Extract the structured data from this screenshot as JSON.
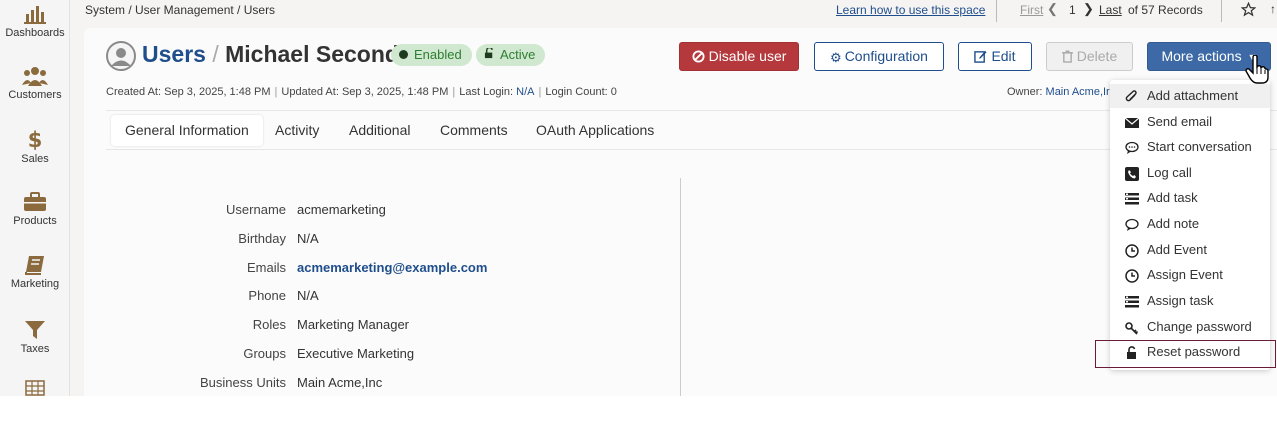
{
  "sidebar": {
    "items": [
      {
        "label": "Dashboards",
        "icon": "bar-chart-icon"
      },
      {
        "label": "Customers",
        "icon": "users-icon"
      },
      {
        "label": "Sales",
        "icon": "dollar-icon"
      },
      {
        "label": "Products",
        "icon": "briefcase-icon"
      },
      {
        "label": "Marketing",
        "icon": "book-icon"
      },
      {
        "label": "Taxes",
        "icon": "filter-icon"
      }
    ]
  },
  "topbar": {
    "breadcrumb": "System / User Management / Users",
    "learn_link": "Learn how to use this space",
    "pager_first": "First",
    "pager_page": "1",
    "pager_last": "Last",
    "pager_count": "of 57 Records"
  },
  "header": {
    "title_section": "Users",
    "title_sep": "/",
    "title_name": "Michael Second",
    "badge_enabled": "Enabled",
    "badge_active": "Active"
  },
  "actions": {
    "disable_user": "Disable user",
    "configuration": "Configuration",
    "edit": "Edit",
    "delete": "Delete",
    "more_actions": "More actions"
  },
  "meta": {
    "created_label": "Created At:",
    "created_value": "Sep 3, 2025, 1:48 PM",
    "updated_label": "Updated At:",
    "updated_value": "Sep 3, 2025, 1:48 PM",
    "last_login_label": "Last Login:",
    "last_login_value": "N/A",
    "login_count_label": "Login Count:",
    "login_count_value": "0",
    "owner_label": "Owner:",
    "owner_value": "Main Acme,Ir"
  },
  "tabs": [
    {
      "label": "General Information",
      "active": true
    },
    {
      "label": "Activity"
    },
    {
      "label": "Additional"
    },
    {
      "label": "Comments"
    },
    {
      "label": "OAuth Applications"
    }
  ],
  "fields": [
    {
      "label": "Username",
      "value": "acmemarketing"
    },
    {
      "label": "Birthday",
      "value": "N/A"
    },
    {
      "label": "Emails",
      "value": "acmemarketing@example.com"
    },
    {
      "label": "Phone",
      "value": "N/A"
    },
    {
      "label": "Roles",
      "value": "Marketing Manager"
    },
    {
      "label": "Groups",
      "value": "Executive Marketing"
    },
    {
      "label": "Business Units",
      "value": "Main Acme,Inc"
    }
  ],
  "more_actions_menu": [
    {
      "label": "Add attachment",
      "icon": "paperclip-icon"
    },
    {
      "label": "Send email",
      "icon": "envelope-icon"
    },
    {
      "label": "Start conversation",
      "icon": "chat-icon"
    },
    {
      "label": "Log call",
      "icon": "phone-icon"
    },
    {
      "label": "Add task",
      "icon": "tasks-icon"
    },
    {
      "label": "Add note",
      "icon": "comment-icon"
    },
    {
      "label": "Add Event",
      "icon": "clock-icon"
    },
    {
      "label": "Assign Event",
      "icon": "clock-icon"
    },
    {
      "label": "Assign task",
      "icon": "tasks-icon"
    },
    {
      "label": "Change password",
      "icon": "key-icon"
    },
    {
      "label": "Reset password",
      "icon": "unlock-icon"
    }
  ],
  "colors": {
    "brand": "#1f4e8c",
    "danger": "#b5393c",
    "primary": "#3d6aa6",
    "success_bg": "#cfe8cf",
    "highlight": "#6a1b3a"
  }
}
